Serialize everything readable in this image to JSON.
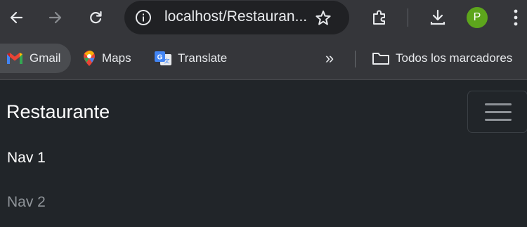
{
  "browser": {
    "url": "localhost/Restauran...",
    "profile_initial": "P",
    "colors": {
      "toolbar": "#35363a",
      "omnibox": "#202124",
      "profile": "#5da51c"
    }
  },
  "bookmarks": {
    "items": [
      {
        "label": "Gmail",
        "icon": "gmail-icon"
      },
      {
        "label": "Maps",
        "icon": "maps-icon"
      },
      {
        "label": "Translate",
        "icon": "translate-icon"
      }
    ],
    "more": "»",
    "all_bookmarks": "Todos los marcadores"
  },
  "navbar": {
    "brand": "Restaurante",
    "toggler_icon": "hamburger-menu-icon",
    "links": [
      {
        "label": "Nav 1",
        "active": true
      },
      {
        "label": "Nav 2",
        "active": false
      }
    ],
    "colors": {
      "background": "#212529",
      "active_link": "#ffffff",
      "muted_link": "#8f9499"
    }
  }
}
